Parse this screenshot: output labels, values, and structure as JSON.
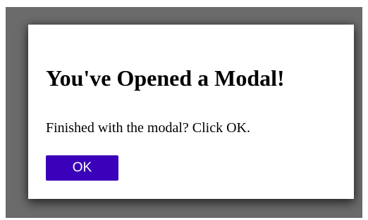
{
  "modal": {
    "title": "You've Opened a Modal!",
    "message": "Finished with the modal? Click OK.",
    "ok_label": "OK"
  },
  "colors": {
    "backdrop": "#6b6b6b",
    "modal_background": "#ffffff",
    "button_background": "#3b00b9",
    "button_text": "#ffffff"
  }
}
